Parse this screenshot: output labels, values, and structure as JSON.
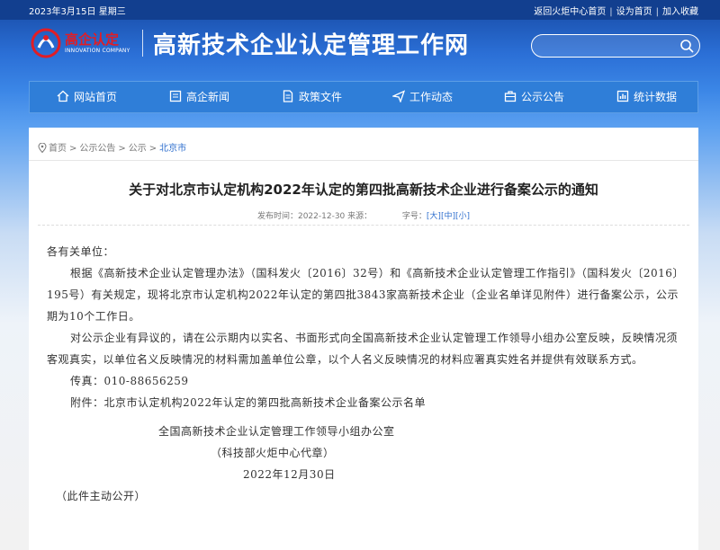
{
  "topbar": {
    "date": "2023年3月15日 星期三",
    "links": [
      "返回火炬中心首页",
      "设为首页",
      "加入收藏"
    ]
  },
  "logo": {
    "cn": "高企认定",
    "en": "INNOVATION COMPANY"
  },
  "site_title": "高新技术企业认定管理工作网",
  "search": {
    "value": "",
    "placeholder": ""
  },
  "nav": [
    {
      "label": "网站首页",
      "icon": "home-icon"
    },
    {
      "label": "高企新闻",
      "icon": "news-icon"
    },
    {
      "label": "政策文件",
      "icon": "document-icon"
    },
    {
      "label": "工作动态",
      "icon": "send-icon"
    },
    {
      "label": "公示公告",
      "icon": "briefcase-icon"
    },
    {
      "label": "统计数据",
      "icon": "chart-icon"
    }
  ],
  "breadcrumb": [
    "首页",
    "公示公告",
    "公示",
    "北京市"
  ],
  "article": {
    "title": "关于对北京市认定机构2022年认定的第四批高新技术企业进行备案公示的通知",
    "meta_time": "发布时间：2022-12-30 来源：",
    "font_size_label": "字号：",
    "font_sizes": [
      "[大]",
      "[中]",
      "[小]"
    ],
    "greeting": "各有关单位：",
    "p1": "根据《高新技术企业认定管理办法》（国科发火〔2016〕32号）和《高新技术企业认定管理工作指引》（国科发火〔2016〕195号）有关规定，现将北京市认定机构2022年认定的第四批3843家高新技术企业（企业名单详见附件）进行备案公示，公示期为10个工作日。",
    "p2": "对公示企业有异议的，请在公示期内以实名、书面形式向全国高新技术企业认定管理工作领导小组办公室反映，反映情况须客观真实，以单位名义反映情况的材料需加盖单位公章，以个人名义反映情况的材料应署真实姓名并提供有效联系方式。",
    "fax": "传真：010-88656259",
    "attachment": "附件：北京市认定机构2022年认定的第四批高新技术企业备案公示名单",
    "sign_org": "全国高新技术企业认定管理工作领导小组办公室",
    "sign_proxy": "（科技部火炬中心代章）",
    "sign_date": "2022年12月30日",
    "footer_note": "（此件主动公开）"
  },
  "colors": {
    "header_dark": "#123f8f",
    "nav_blue": "#2f7ed8",
    "logo_red": "#e11d25",
    "link_blue": "#2f6fce"
  }
}
